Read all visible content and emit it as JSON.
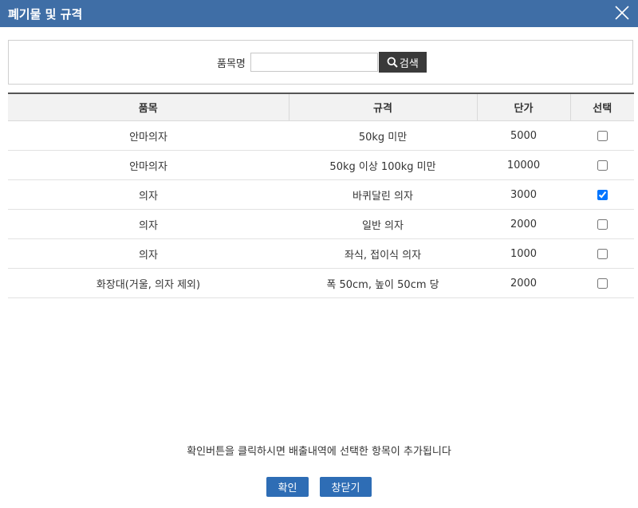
{
  "window": {
    "title": "폐기물 및 규격",
    "close_icon": "close-icon"
  },
  "search": {
    "label": "품목명",
    "value": "",
    "placeholder": "",
    "button_label": "검색",
    "button_icon": "search-icon"
  },
  "table": {
    "headers": [
      "품목",
      "규격",
      "단가",
      "선택"
    ],
    "rows": [
      {
        "item": "안마의자",
        "spec": "50kg 미만",
        "price": "5000",
        "checked": false
      },
      {
        "item": "안마의자",
        "spec": "50kg 이상 100kg 미만",
        "price": "10000",
        "checked": false
      },
      {
        "item": "의자",
        "spec": "바퀴달린 의자",
        "price": "3000",
        "checked": true
      },
      {
        "item": "의자",
        "spec": "일반 의자",
        "price": "2000",
        "checked": false
      },
      {
        "item": "의자",
        "spec": "좌식, 접이식 의자",
        "price": "1000",
        "checked": false
      },
      {
        "item": "화장대(거울, 의자 제외)",
        "spec": "폭 50cm, 높이 50cm 당",
        "price": "2000",
        "checked": false
      }
    ]
  },
  "notice": "확인버튼을 클릭하시면 배출내역에 선택한 항목이 추가됩니다",
  "buttons": {
    "confirm": "확인",
    "close": "창닫기"
  },
  "colors": {
    "titlebar": "#3f6ea6",
    "button": "#2e6db5",
    "search_button": "#3a3a3a"
  }
}
